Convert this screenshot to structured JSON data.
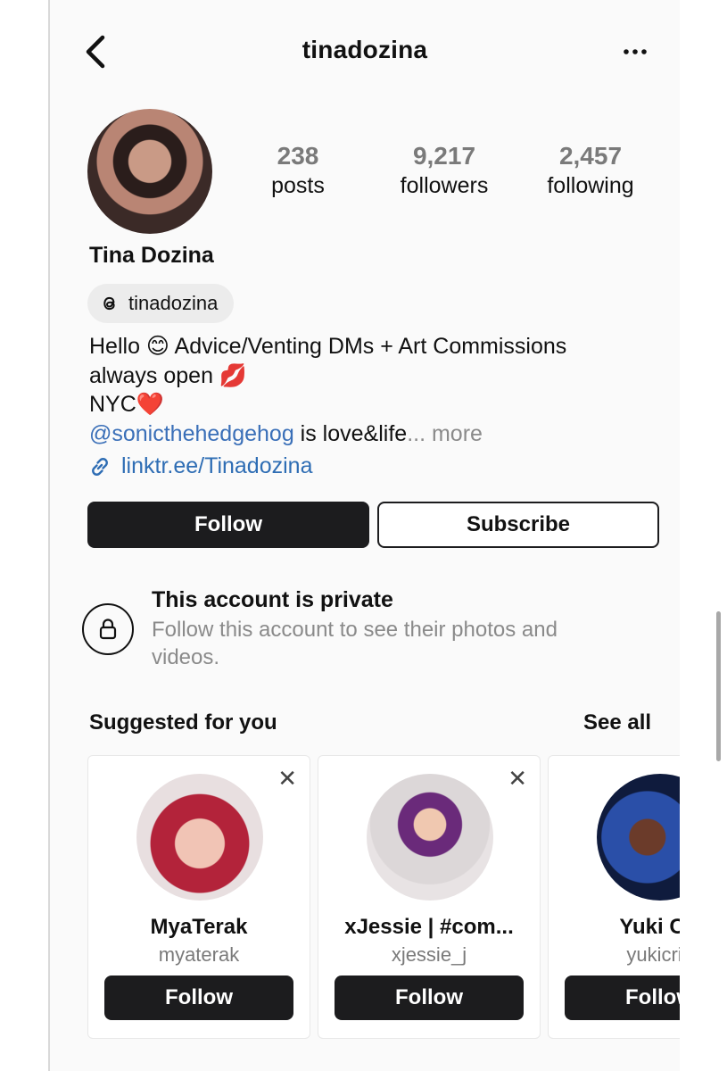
{
  "header": {
    "title": "tinadozina"
  },
  "profile": {
    "display_name": "Tina Dozina",
    "threads_handle": "tinadozina",
    "stats": [
      {
        "value": "238",
        "label": "posts"
      },
      {
        "value": "9,217",
        "label": "followers"
      },
      {
        "value": "2,457",
        "label": "following"
      }
    ],
    "bio": {
      "line1": "Hello 😊 Advice/Venting DMs + Art Commissions",
      "line2": "always open 💋",
      "line3": "NYC❤️",
      "mention": "@sonicthehedgehog",
      "line4_rest": " is love&life",
      "ellipsis": "...",
      "more_label": "more"
    },
    "link": "linktr.ee/Tinadozina"
  },
  "actions": {
    "follow_label": "Follow",
    "subscribe_label": "Subscribe"
  },
  "private_notice": {
    "title": "This account is private",
    "subtitle": "Follow this account to see their photos and videos."
  },
  "suggested": {
    "title": "Suggested for you",
    "see_all_label": "See all",
    "cards": [
      {
        "name": "MyaTerak",
        "handle": "myaterak",
        "button": "Follow",
        "close": "✕"
      },
      {
        "name": "xJessie | #com...",
        "handle": "xjessie_j",
        "button": "Follow",
        "close": "✕"
      },
      {
        "name": "Yuki Cri",
        "handle": "yukicris",
        "button": "Follow",
        "close": "✕"
      }
    ]
  }
}
